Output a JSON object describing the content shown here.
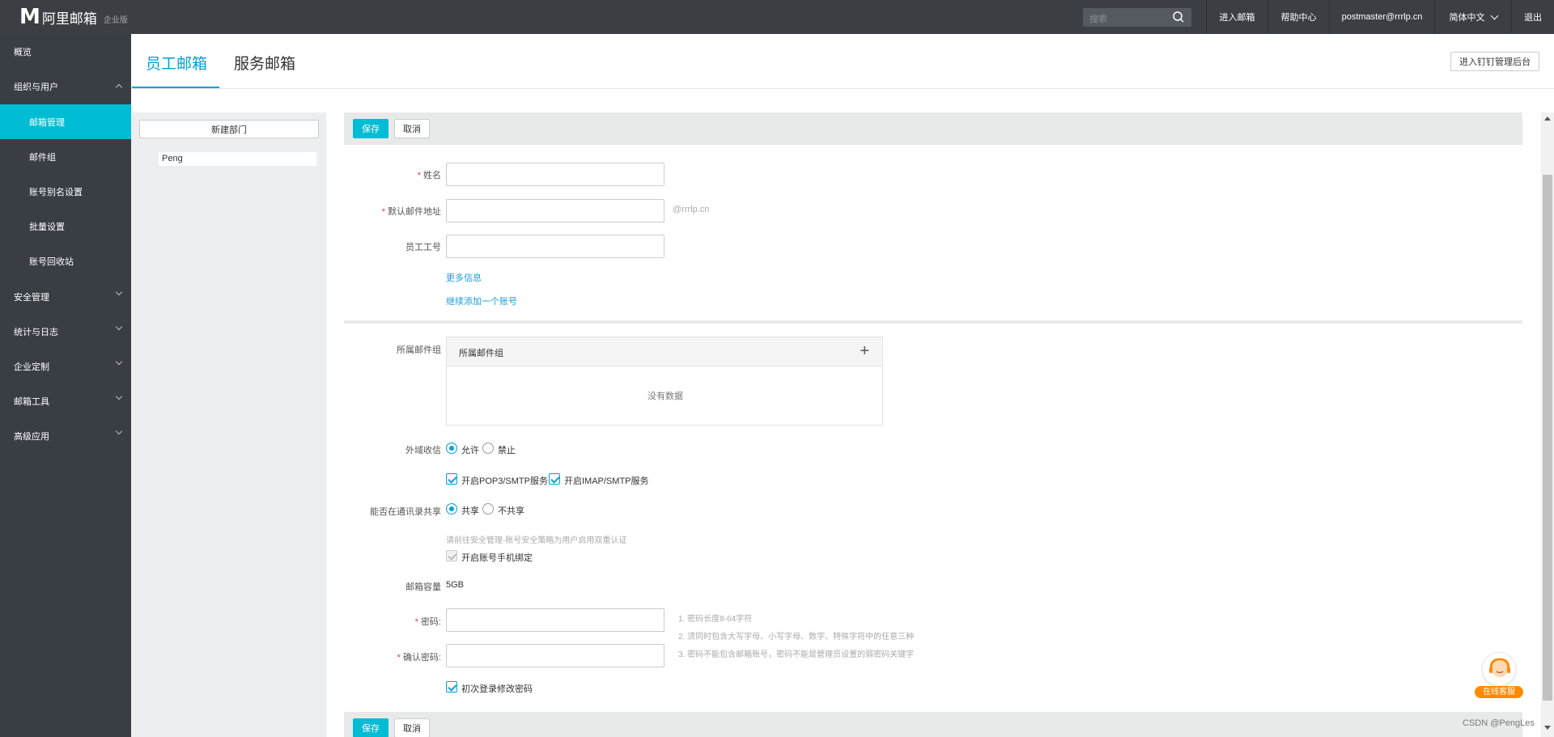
{
  "colors": {
    "accent": "#00bcd4",
    "link": "#1a9ed8",
    "topbar": "#3b3f44",
    "sidebar": "#393e44",
    "required": "#e4393c"
  },
  "brand": {
    "logo_mark": "M",
    "name": "阿里邮箱",
    "edition": "企业版"
  },
  "topbar": {
    "search_placeholder": "搜索",
    "enter_mail": "进入邮箱",
    "help_center": "帮助中心",
    "account": "postmaster@rrrlp.cn",
    "language": "简体中文",
    "logout": "退出"
  },
  "sidebar": {
    "overview": "概览",
    "org_users": "组织与用户",
    "mailbox_mgmt": "邮箱管理",
    "mail_group": "邮件组",
    "alias_settings": "账号别名设置",
    "batch_settings": "批量设置",
    "recycle_bin": "账号回收站",
    "security": "安全管理",
    "stats_logs": "统计与日志",
    "enterprise_custom": "企业定制",
    "mail_tools": "邮箱工具",
    "advanced_apps": "高级应用"
  },
  "tabs": {
    "employee": "员工邮箱",
    "service": "服务邮箱"
  },
  "dingtalk_button": "进入钉钉管理后台",
  "departments": {
    "new_button": "新建部门",
    "items": [
      "Peng"
    ]
  },
  "form": {
    "save": "保存",
    "cancel": "取消",
    "name_label": "姓名",
    "email_label": "默认邮件地址",
    "domain_suffix": "@rrrlp.cn",
    "employee_id_label": "员工工号",
    "more_info": "更多信息",
    "add_another": "继续添加一个账号",
    "mail_group_label": "所属邮件组",
    "mail_group_header": "所属邮件组",
    "no_data": "没有数据",
    "external_label": "外域收信",
    "allow": "允许",
    "deny": "禁止",
    "pop3": "开启POP3/SMTP服务",
    "imap": "开启IMAP/SMTP服务",
    "share_label": "能否在通讯录共享",
    "share": "共享",
    "no_share": "不共享",
    "security_hint": "请前往安全管理-账号安全策略为用户启用双重认证",
    "phone_binding": "开启账号手机绑定",
    "capacity_label": "邮箱容量",
    "capacity_value": "5GB",
    "password_label": "密码:",
    "confirm_label": "确认密码:",
    "pw_rule_1": "1. 密码长度8-64字符",
    "pw_rule_2": "2. 须同时包含大写字母、小写字母、数字、特殊字符中的任意三种",
    "pw_rule_3": "3. 密码不能包含邮箱账号，密码不能是管理员设置的弱密码关键字",
    "change_pw_first_login": "初次登录修改密码"
  },
  "customer_service": "在线客服",
  "watermark": "CSDN @PengLes"
}
